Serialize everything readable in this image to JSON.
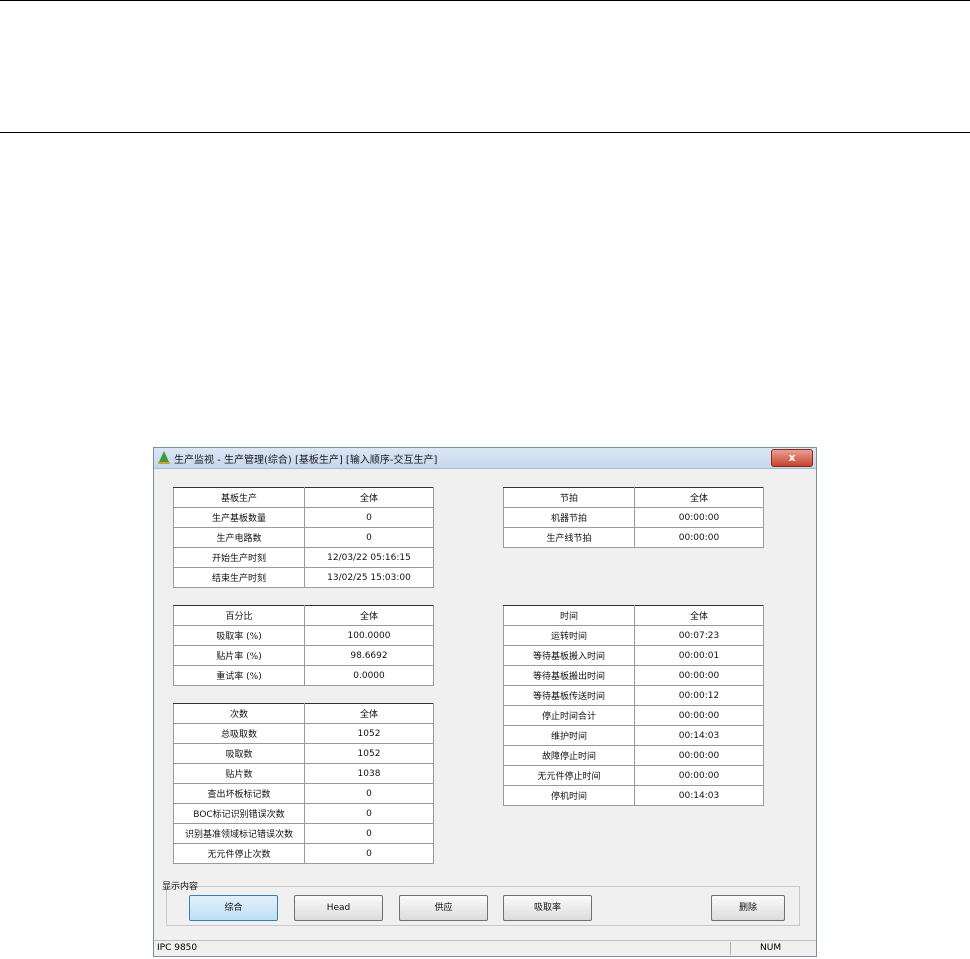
{
  "window": {
    "title": "生产监视 - 生产管理(综合) [基板生产] [输入顺序-交互生产]",
    "close_label": "x"
  },
  "board_production": {
    "header": [
      "基板生产",
      "全体"
    ],
    "rows": [
      [
        "生产基板数量",
        "0"
      ],
      [
        "生产电路数",
        "0"
      ],
      [
        "开始生产时刻",
        "12/03/22 05:16:15"
      ],
      [
        "结束生产时刻",
        "13/02/25 15:03:00"
      ]
    ]
  },
  "percentage": {
    "header": [
      "百分比",
      "全体"
    ],
    "rows": [
      [
        "吸取率 (%)",
        "100.0000"
      ],
      [
        "贴片率 (%)",
        "98.6692"
      ],
      [
        "重试率 (%)",
        "0.0000"
      ]
    ]
  },
  "counts": {
    "header": [
      "次数",
      "全体"
    ],
    "rows": [
      [
        "总吸取数",
        "1052"
      ],
      [
        "吸取数",
        "1052"
      ],
      [
        "贴片数",
        "1038"
      ],
      [
        "查出坏板标记数",
        "0"
      ],
      [
        "BOC标记识别错误次数",
        "0"
      ],
      [
        "识别基准领域标记错误次数",
        "0"
      ],
      [
        "无元件停止次数",
        "0"
      ]
    ]
  },
  "tact": {
    "header": [
      "节拍",
      "全体"
    ],
    "rows": [
      [
        "机器节拍",
        "00:00:00"
      ],
      [
        "生产线节拍",
        "00:00:00"
      ]
    ]
  },
  "time": {
    "header": [
      "时间",
      "全体"
    ],
    "rows": [
      [
        "运转时间",
        "00:07:23"
      ],
      [
        "等待基板搬入时间",
        "00:00:01"
      ],
      [
        "等待基板搬出时间",
        "00:00:00"
      ],
      [
        "等待基板传送时间",
        "00:00:12"
      ],
      [
        "停止时间合计",
        "00:00:00"
      ],
      [
        "维护时间",
        "00:14:03"
      ],
      [
        "故障停止时间",
        "00:00:00"
      ],
      [
        "无元件停止时间",
        "00:00:00"
      ],
      [
        "停机时间",
        "00:14:03"
      ]
    ]
  },
  "display": {
    "group_label": "显示内容",
    "buttons": [
      "综合",
      "Head",
      "供应",
      "吸取率"
    ],
    "delete_label": "删除"
  },
  "status": {
    "left": "IPC 9850",
    "right": "NUM"
  }
}
